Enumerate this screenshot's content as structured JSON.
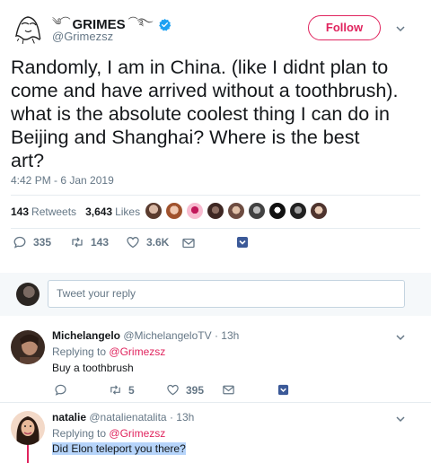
{
  "tweet": {
    "author_name": "GRIMES",
    "author_ornament_left": "༄⌒",
    "author_ornament_right": "⌒࿐",
    "author_handle": "@Grimezsz",
    "follow_label": "Follow",
    "text": "Randomly, I am in China. (like I didnt plan to\ncome and have arrived without a toothbrush).\nwhat is the absolute coolest thing I can do in\nBeijing and Shanghai?  Where is the best\nart?",
    "timestamp": "4:42 PM - 6 Jan 2019",
    "retweets_count": "143",
    "retweets_label": "Retweets",
    "likes_count": "3,643",
    "likes_label": "Likes"
  },
  "actions": {
    "replies": "335",
    "retweets": "143",
    "likes": "3.6K"
  },
  "compose": {
    "placeholder": "Tweet your reply"
  },
  "replies": [
    {
      "name": "Michelangelo",
      "handle": "@MichelangeloTV",
      "time": "· 13h",
      "replying_label": "Replying to",
      "replying_to": "@Grimezsz",
      "text": "Buy a toothbrush",
      "retweets": "5",
      "likes": "395"
    },
    {
      "name": "natalie",
      "handle": "@natalienatalita",
      "time": "· 13h",
      "replying_label": "Replying to",
      "replying_to": "@Grimezsz",
      "text": "Did Elon teleport you there?"
    }
  ],
  "colors": {
    "accent": "#e0245e",
    "secondary_text": "#657786",
    "verified": "#1da1f2",
    "selection": "#b6d4fa"
  }
}
